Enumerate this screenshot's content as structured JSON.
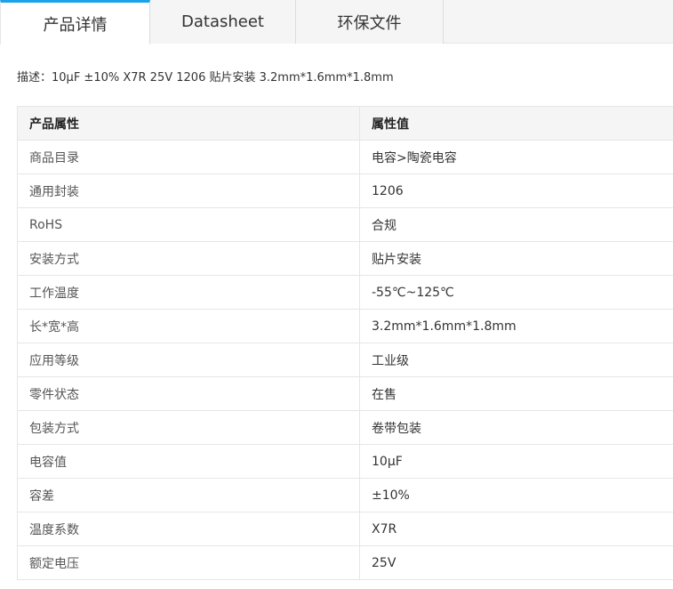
{
  "tabs": [
    {
      "label": "产品详情",
      "active": true
    },
    {
      "label": "Datasheet",
      "active": false
    },
    {
      "label": "环保文件",
      "active": false
    }
  ],
  "description": "描述：10μF ±10% X7R 25V 1206 贴片安装 3.2mm*1.6mm*1.8mm",
  "table": {
    "headers": [
      "产品属性",
      "属性值"
    ],
    "rows": [
      {
        "key": "商品目录",
        "value": "电容>陶瓷电容"
      },
      {
        "key": "通用封装",
        "value": "1206"
      },
      {
        "key": "RoHS",
        "value": "合规"
      },
      {
        "key": "安装方式",
        "value": "贴片安装"
      },
      {
        "key": "工作温度",
        "value": "-55℃~125℃"
      },
      {
        "key": "长*宽*高",
        "value": "3.2mm*1.6mm*1.8mm"
      },
      {
        "key": "应用等级",
        "value": "工业级"
      },
      {
        "key": "零件状态",
        "value": "在售"
      },
      {
        "key": "包装方式",
        "value": "卷带包装"
      },
      {
        "key": "电容值",
        "value": "10μF"
      },
      {
        "key": "容差",
        "value": "±10%"
      },
      {
        "key": "温度系数",
        "value": "X7R"
      },
      {
        "key": "额定电压",
        "value": "25V"
      }
    ]
  },
  "colors": {
    "accent": "#1aa3e8"
  }
}
